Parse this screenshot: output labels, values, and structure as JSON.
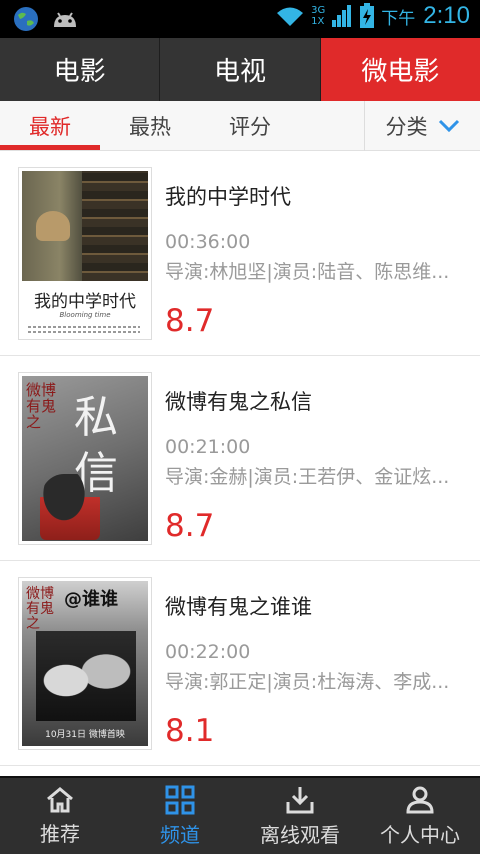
{
  "status": {
    "ampm": "下午",
    "time": "2:10",
    "network": "3G",
    "sim": "1X"
  },
  "top_tabs": [
    {
      "label": "电影"
    },
    {
      "label": "电视"
    },
    {
      "label": "微电影",
      "active": true
    }
  ],
  "sub_tabs": [
    {
      "label": "最新",
      "active": true
    },
    {
      "label": "最热"
    },
    {
      "label": "评分"
    }
  ],
  "category": {
    "label": "分类"
  },
  "movies": [
    {
      "title": "我的中学时代",
      "duration": "00:36:00",
      "crew": "导演:林旭坚|演员:陆音、陈思维...",
      "score": "8.7",
      "poster_title": "我的中学时代",
      "poster_sub": "Blooming time"
    },
    {
      "title": "微博有鬼之私信",
      "duration": "00:21:00",
      "crew": "导演:金赫|演员:王若伊、金证炫...",
      "score": "8.7",
      "poster_title": "私信",
      "poster_series": "微博有鬼之"
    },
    {
      "title": "微博有鬼之谁谁",
      "duration": "00:22:00",
      "crew": "导演:郭正定|演员:杜海涛、李成...",
      "score": "8.1",
      "poster_title": "@谁谁",
      "poster_series": "微博有鬼之",
      "poster_date": "10月31日 微博首映"
    }
  ],
  "bottom_nav": [
    {
      "label": "推荐",
      "icon": "home-icon"
    },
    {
      "label": "频道",
      "icon": "grid-icon",
      "active": true
    },
    {
      "label": "离线观看",
      "icon": "download-icon"
    },
    {
      "label": "个人中心",
      "icon": "user-icon"
    }
  ],
  "colors": {
    "accent": "#e02a2a",
    "active_blue": "#2f93e8"
  }
}
